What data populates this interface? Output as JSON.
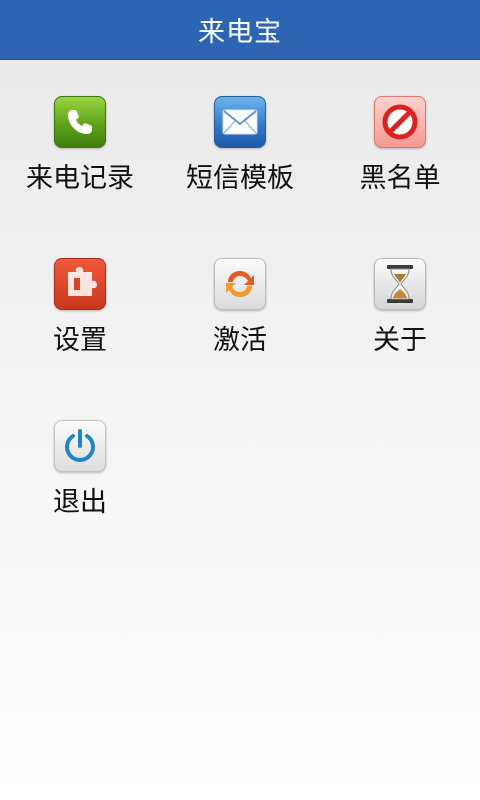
{
  "app": {
    "title": "来电宝"
  },
  "menu": {
    "items": [
      {
        "label": "来电记录",
        "icon": "phone-icon"
      },
      {
        "label": "短信模板",
        "icon": "envelope-icon"
      },
      {
        "label": "黑名单",
        "icon": "block-icon"
      },
      {
        "label": "设置",
        "icon": "puzzle-icon"
      },
      {
        "label": "激活",
        "icon": "refresh-arrows-icon"
      },
      {
        "label": "关于",
        "icon": "hourglass-icon"
      },
      {
        "label": "退出",
        "icon": "power-icon"
      }
    ]
  },
  "colors": {
    "title_bar": "#2d64b3",
    "title_text": "#ffffff",
    "label_text": "#111111"
  }
}
